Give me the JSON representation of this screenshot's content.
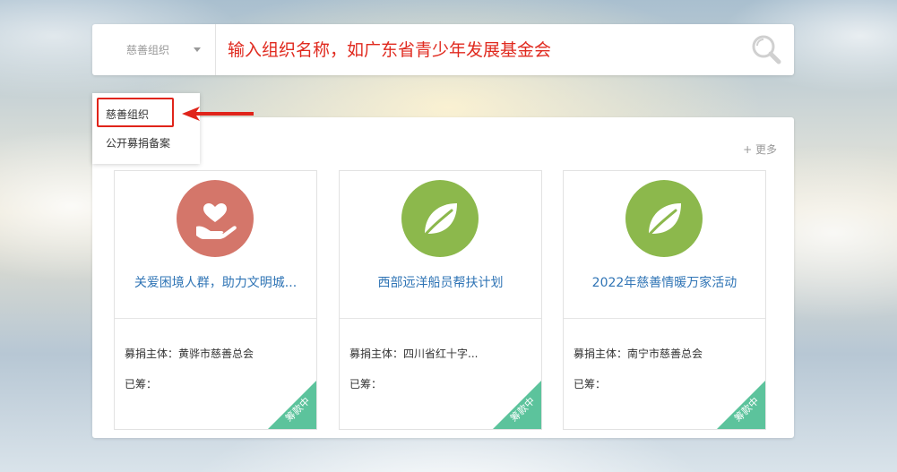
{
  "search": {
    "type_label": "慈善组织",
    "placeholder": "输入组织名称，如广东省青少年发展基金会"
  },
  "dropdown": {
    "items": [
      {
        "label": "慈善组织"
      },
      {
        "label": "公开募捐备案"
      }
    ]
  },
  "panel": {
    "more_label": "+ 更多"
  },
  "cards": [
    {
      "title": "关爱困境人群，助力文明城...",
      "org": "募捐主体：黄骅市慈善总会",
      "raised": "已筹：",
      "status": "筹款中",
      "icon": "heart-hand-icon"
    },
    {
      "title": "西部远洋船员帮扶计划",
      "org": "募捐主体：四川省红十字...",
      "raised": "已筹：",
      "status": "筹款中",
      "icon": "leaf-icon"
    },
    {
      "title": "2022年慈善情暖万家活动",
      "org": "募捐主体：南宁市慈善总会",
      "raised": "已筹：",
      "status": "筹款中",
      "icon": "leaf-icon"
    }
  ],
  "colors": {
    "accent_red": "#e02a1f",
    "link_blue": "#2f74b5",
    "icon_red": "#d4766a",
    "icon_green": "#8cb84c",
    "ribbon_green": "#5cc39c"
  }
}
